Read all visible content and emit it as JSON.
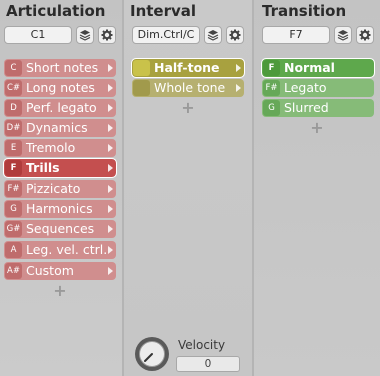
{
  "articulation": {
    "heading": "Articulation",
    "field": "C1",
    "items": [
      {
        "key": "C",
        "label": "Short notes",
        "selected": false
      },
      {
        "key": "C#",
        "label": "Long notes",
        "selected": false
      },
      {
        "key": "D",
        "label": "Perf. legato",
        "selected": false
      },
      {
        "key": "D#",
        "label": "Dynamics",
        "selected": false
      },
      {
        "key": "E",
        "label": "Tremolo",
        "selected": false
      },
      {
        "key": "F",
        "label": "Trills",
        "selected": true
      },
      {
        "key": "F#",
        "label": "Pizzicato",
        "selected": false
      },
      {
        "key": "G",
        "label": "Harmonics",
        "selected": false
      },
      {
        "key": "G#",
        "label": "Sequences",
        "selected": false
      },
      {
        "key": "A",
        "label": "Leg. vel. ctrl.",
        "selected": false
      },
      {
        "key": "A#",
        "label": "Custom",
        "selected": false
      }
    ],
    "add": "+"
  },
  "interval": {
    "heading": "Interval",
    "field": "Dim.Ctrl/C",
    "items": [
      {
        "key": "",
        "label": "Half-tone",
        "selected": true
      },
      {
        "key": "",
        "label": "Whole tone",
        "selected": false
      }
    ],
    "add": "+"
  },
  "transition": {
    "heading": "Transition",
    "field": "F7",
    "items": [
      {
        "key": "F",
        "label": "Normal",
        "selected": true
      },
      {
        "key": "F#",
        "label": "Legato",
        "selected": false
      },
      {
        "key": "G",
        "label": "Slurred",
        "selected": false
      }
    ],
    "add": "+"
  },
  "velocity": {
    "label": "Velocity",
    "value": "0"
  },
  "colors": {
    "articulation": "#d08e8e",
    "interval": "#b6b070",
    "transition": "#86bb78",
    "selected_outline": "#ffffff"
  },
  "icons": [
    "layers-icon",
    "gear-icon",
    "chevron-right-icon",
    "plus-icon",
    "knob-icon"
  ]
}
